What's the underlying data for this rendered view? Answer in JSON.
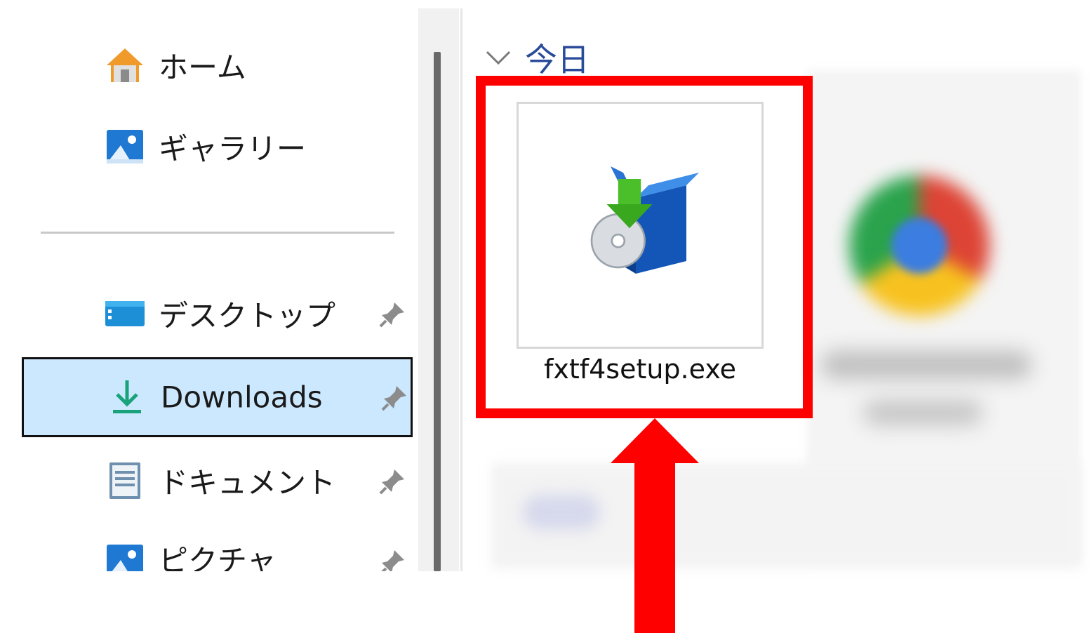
{
  "nav": {
    "items": [
      {
        "label": "ホーム",
        "icon": "home-icon",
        "pinned": false
      },
      {
        "label": "ギャラリー",
        "icon": "gallery-icon",
        "pinned": false
      },
      {
        "label": "デスクトップ",
        "icon": "desktop-icon",
        "pinned": true
      },
      {
        "label": "Downloads",
        "icon": "download-icon",
        "pinned": true,
        "selected": true
      },
      {
        "label": "ドキュメント",
        "icon": "document-icon",
        "pinned": true
      },
      {
        "label": "ピクチャ",
        "icon": "pictures-icon",
        "pinned": true
      }
    ]
  },
  "content": {
    "group_title": "今日",
    "file": {
      "name": "fxtf4setup.exe",
      "icon": "installer-icon"
    }
  },
  "colors": {
    "highlight": "#ff0000",
    "selection_bg": "#cce8ff",
    "group_title": "#2a4a9a"
  }
}
